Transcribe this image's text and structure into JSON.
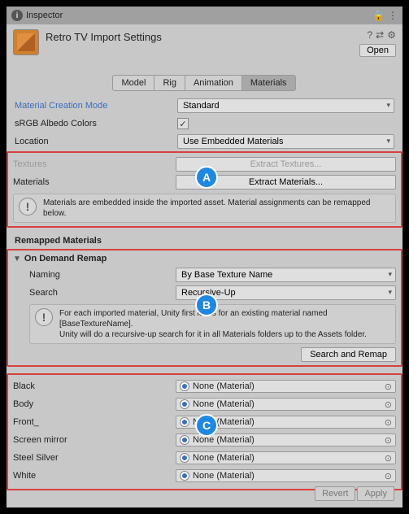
{
  "titlebar": {
    "title": "Inspector"
  },
  "header": {
    "title": "Retro TV Import Settings",
    "open": "Open"
  },
  "tabs": [
    {
      "label": "Model",
      "active": false
    },
    {
      "label": "Rig",
      "active": false
    },
    {
      "label": "Animation",
      "active": false
    },
    {
      "label": "Materials",
      "active": true
    }
  ],
  "rows": {
    "mat_creation_label": "Material Creation Mode",
    "mat_creation_value": "Standard",
    "srgb_label": "sRGB Albedo Colors",
    "location_label": "Location",
    "location_value": "Use Embedded Materials",
    "textures_label": "Textures",
    "textures_btn": "Extract Textures...",
    "materials_label": "Materials",
    "materials_btn": "Extract Materials..."
  },
  "info_a": "Materials are embedded inside the imported asset. Material assignments can be remapped below.",
  "remapped_title": "Remapped Materials",
  "remap_fold": "On Demand Remap",
  "remap": {
    "naming_label": "Naming",
    "naming_value": "By Base Texture Name",
    "search_label": "Search",
    "search_value": "Recursive-Up"
  },
  "info_b": "For each imported material, Unity first looks for an existing material named [BaseTextureName].\nUnity will do a recursive-up search for it in all Materials folders up to the Assets folder.",
  "search_remap_btn": "Search and Remap",
  "materials": [
    {
      "name": "Black",
      "value": "None (Material)"
    },
    {
      "name": "Body",
      "value": "None (Material)"
    },
    {
      "name": "Front_",
      "value": "None (Material)"
    },
    {
      "name": "Screen mirror",
      "value": "None (Material)"
    },
    {
      "name": "Steel Silver",
      "value": "None (Material)"
    },
    {
      "name": "White",
      "value": "None (Material)"
    }
  ],
  "footer": {
    "revert": "Revert",
    "apply": "Apply"
  },
  "badges": {
    "a": "A",
    "b": "B",
    "c": "C"
  }
}
